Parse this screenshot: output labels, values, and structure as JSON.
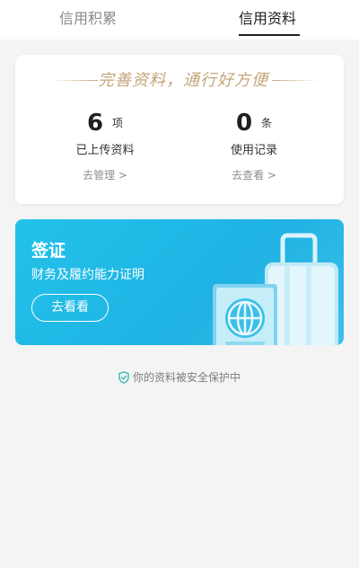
{
  "tabs": [
    {
      "label": "信用积累",
      "active": false
    },
    {
      "label": "信用资料",
      "active": true
    }
  ],
  "summary": {
    "slogan": "完善资料，通行好方便",
    "uploaded": {
      "count": "6",
      "unit": "项",
      "label": "已上传资料",
      "link": "去管理 >"
    },
    "records": {
      "count": "0",
      "unit": "条",
      "label": "使用记录",
      "link": "去查看 >"
    }
  },
  "banner": {
    "title": "签证",
    "subtitle": "财务及履约能力证明",
    "button": "去看看",
    "illustration": "passport-and-suitcase"
  },
  "footer": {
    "security_text": "你的资料被安全保护中",
    "icon": "shield-check-icon"
  },
  "colors": {
    "accent_gold": "#c6a67a",
    "banner_blue": "#23c2ea",
    "shield_teal": "#2bb5a6"
  }
}
